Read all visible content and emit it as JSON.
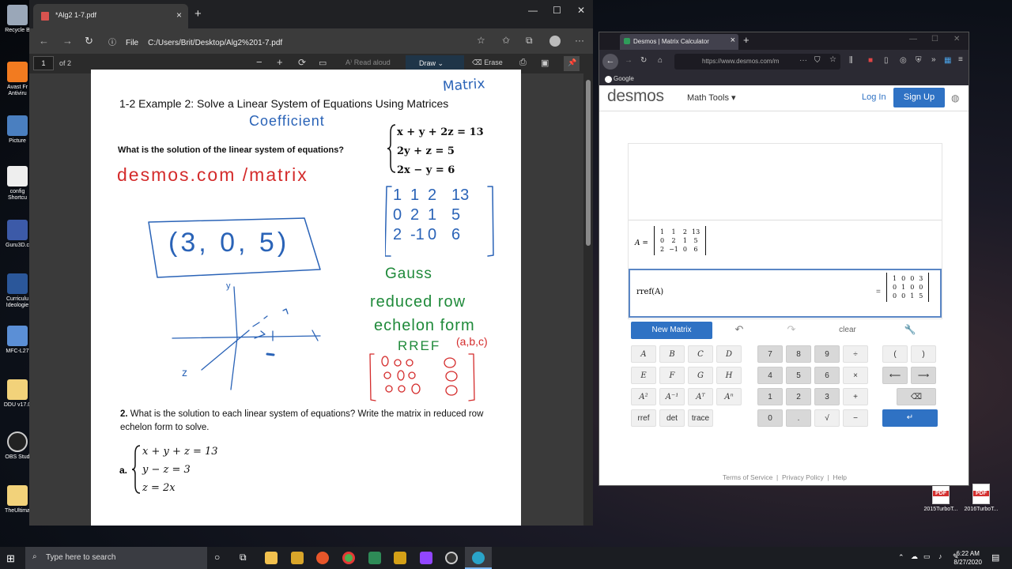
{
  "desktop": {
    "icons": [
      "Recycle B",
      "Avast Fr Antiviru",
      "Picture",
      "config Shortcu",
      "Guru3D.c",
      "Curriculu Ideologie",
      "MFC-L27",
      "DDU v17.0",
      "OBS Stud",
      "TheUltima"
    ],
    "right_icons": [
      "2015TurboT...",
      "2016TurboT..."
    ]
  },
  "edge": {
    "tab_title": "*Alg2 1-7.pdf",
    "address_label": "File",
    "address": "C:/Users/Brit/Desktop/Alg2%201-7.pdf",
    "page_number": "1",
    "page_of": "of 2",
    "read_aloud": "Read aloud",
    "draw": "Draw",
    "erase": "Erase"
  },
  "pdf": {
    "title": "1-2 Example 2: Solve a Linear System of Equations Using Matrices",
    "question": "What is the solution of the linear system of equations?",
    "equations": [
      "x + y + 2z = 13",
      "2y + z = 5",
      "2x − y = 6"
    ],
    "q2_number": "2.",
    "q2_text": "What is the solution to each linear system of equations? Write the matrix in reduced row echelon form to solve.",
    "part_a": "a.",
    "system_a": [
      "x + y + z = 13",
      "y − z = 3",
      "z = 2x"
    ],
    "handwriting": {
      "matrix": "Matrix",
      "coefficient": "Coefficient",
      "url": "desmos.com /matrix",
      "answer": "(3, 0, 5)",
      "gauss": "Gauss",
      "rref1": "reduced row",
      "rref2": "echelon form",
      "rref3": "RREF",
      "abc": "(a,b,c)",
      "matrix_rows": [
        [
          "1",
          "1",
          "2",
          "13"
        ],
        [
          "0",
          "2",
          "1",
          "5"
        ],
        [
          "2",
          "-1",
          "0",
          "6"
        ]
      ],
      "axis_y": "y",
      "axis_z": "z"
    }
  },
  "firefox": {
    "tab_title": "Desmos | Matrix Calculator",
    "url": "https://www.desmos.com/m",
    "bookmark": "Google"
  },
  "desmos": {
    "logo": "desmos",
    "math_tools": "Math Tools ▾",
    "login": "Log In",
    "signup": "Sign Up",
    "matrix_name": "A =",
    "matrix_A": [
      [
        "1",
        "1",
        "2",
        "13"
      ],
      [
        "0",
        "2",
        "1",
        "5"
      ],
      [
        "2",
        "−1",
        "0",
        "6"
      ]
    ],
    "expression": "rref(A)",
    "equals": "=",
    "result": [
      [
        "1",
        "0",
        "0",
        "3"
      ],
      [
        "0",
        "1",
        "0",
        "0"
      ],
      [
        "0",
        "0",
        "1",
        "5"
      ]
    ],
    "new_matrix": "New Matrix",
    "clear": "clear",
    "keys": {
      "letters": [
        "A",
        "B",
        "C",
        "D",
        "E",
        "F",
        "G",
        "H"
      ],
      "ops": [
        "A²",
        "A⁻¹",
        "Aᵀ",
        "Aⁿ",
        "rref",
        "det",
        "trace"
      ],
      "digits": [
        "7",
        "8",
        "9",
        "÷",
        "4",
        "5",
        "6",
        "×",
        "1",
        "2",
        "3",
        "+",
        "0",
        ".",
        "√",
        "−"
      ],
      "parens": [
        "(",
        ")"
      ],
      "arrows": [
        "⟵",
        "⟶"
      ]
    },
    "footer": [
      "Terms of Service",
      "Privacy Policy",
      "Help"
    ]
  },
  "taskbar": {
    "search_placeholder": "Type here to search",
    "time": "6:22 AM",
    "date": "8/27/2020"
  }
}
